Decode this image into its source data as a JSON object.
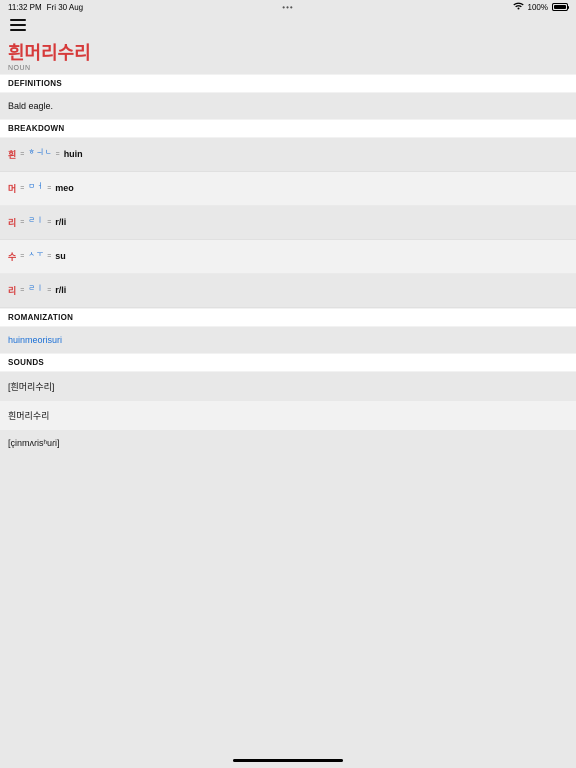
{
  "statusbar": {
    "time": "11:32 PM",
    "date": "Fri 30 Aug",
    "dots": "•••",
    "battery_pct": "100%"
  },
  "entry": {
    "word": "흰머리수리",
    "pos": "NOUN"
  },
  "sections": {
    "definitions": "DEFINITIONS",
    "breakdown": "BREAKDOWN",
    "romanization": "ROMANIZATION",
    "sounds": "SOUNDS"
  },
  "definitions": [
    "Bald eagle."
  ],
  "breakdown": [
    {
      "syllable": "흰",
      "jamo": "ㅎ ㅢ ㄴ",
      "roman": "huin"
    },
    {
      "syllable": "머",
      "jamo": "ㅁ ㅓ",
      "roman": "meo"
    },
    {
      "syllable": "리",
      "jamo": "ㄹ ㅣ",
      "roman": "r/li"
    },
    {
      "syllable": "수",
      "jamo": "ㅅ ㅜ",
      "roman": "su"
    },
    {
      "syllable": "리",
      "jamo": "ㄹ ㅣ",
      "roman": "r/li"
    }
  ],
  "romanization": "huinmeorisuri",
  "sounds": [
    "[흰머리수리]",
    "흰머리수리",
    "[çinmʌɾisʰuɾi]"
  ]
}
